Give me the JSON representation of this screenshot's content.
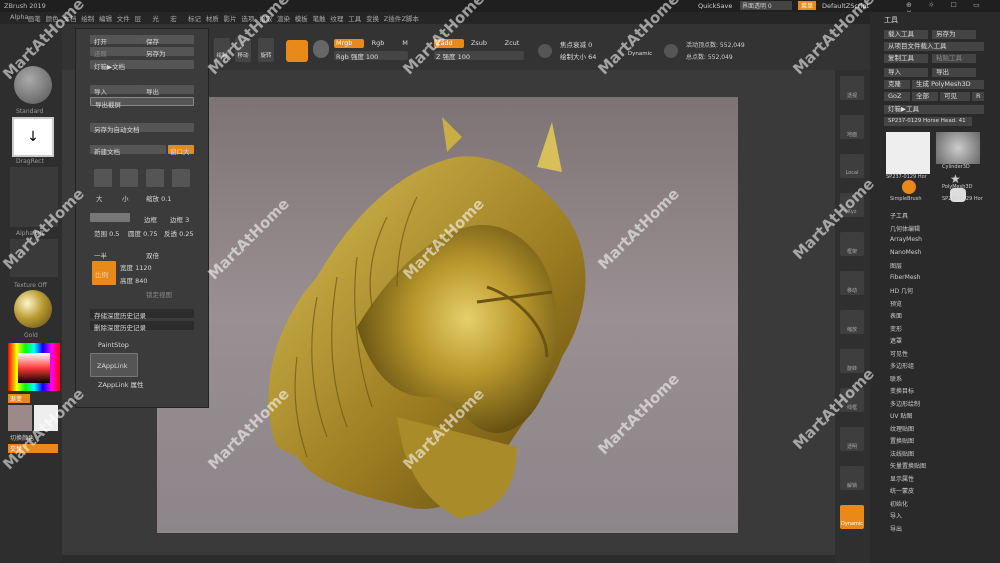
{
  "app": {
    "title": "ZBrush 2019",
    "quicksave": "QuickSave",
    "transparency": "界面透明 0",
    "menu_label": "菜单",
    "script": "DefaultZScript"
  },
  "menubar": [
    "Alpha",
    "画笔",
    "颜色",
    "文档",
    "绘制",
    "编辑",
    "文件",
    "层",
    "光",
    "宏",
    "标记",
    "材质",
    "影片",
    "选项",
    "拾取",
    "渲染",
    "模板",
    "笔触",
    "纹理",
    "工具",
    "变换",
    "Z插件",
    "Z脚本"
  ],
  "toolbar": {
    "edit": "Edit",
    "draw": "绘制",
    "move": "移动",
    "scale": "缩放",
    "rotate": "旋转",
    "mrgb": "Mrgb",
    "rgb": "Rgb",
    "m": "M",
    "zadd": "Zadd",
    "zsub": "Zsub",
    "zcut": "Zcut",
    "rgb_intensity": "Rgb 强度 100",
    "z_intensity": "Z 强度 100",
    "focal": "焦点衰减 0",
    "draw_size": "绘制大小 64",
    "dynamic": "Dynamic",
    "active_points": "活动顶点数: 552,049",
    "total_points": "总点数: 552,049"
  },
  "docmenu": {
    "open": "打开",
    "save": "保存",
    "revert": "还原",
    "save_as": "另存为",
    "lightbox": "灯箱▶文档",
    "import": "导入",
    "export": "导出",
    "export_screen": "导出截屏",
    "save_as_auto": "另存为自动文档",
    "new_doc": "新建文档",
    "wsize": "窗口大",
    "zoom_icons": [
      "实际",
      "AAHalf",
      "缩放",
      "反缩放"
    ],
    "big": "大",
    "small": "小",
    "zoom_val": "缩放 0.1",
    "range": "范围 0.5",
    "contrast": "边框",
    "border": "边框 3",
    "roundness": "圆度 0.75",
    "transp": "反透 0.25",
    "prop": "比例",
    "wide": "宽度 1120",
    "high": "高度 840",
    "half": "一半",
    "double": "双倍",
    "lock_view": "锁定视图",
    "store_depth": "存储深度历史记录",
    "delete_depth": "删除深度历史记录",
    "paintstop": "PaintStop",
    "zapplink": "ZAppLink",
    "zapplink_props": "ZAppLink 属性"
  },
  "leftshelf": {
    "brush": "Standard",
    "stroke": "DragRect",
    "alpha": "Alpha Off",
    "texture": "Texture Off",
    "material": "Gold",
    "main_color": "渐变",
    "switch_color": "切换颜色",
    "alt": "交替"
  },
  "rightshelf": [
    "透视",
    "地面",
    "Local",
    "Xyz",
    "框架",
    "移动",
    "缩放",
    "旋转",
    "线框",
    "透明",
    "解锁",
    "Dynamic"
  ],
  "toolpanel": {
    "title": "工具",
    "load": "载入工具",
    "save_as": "另存为",
    "load_from": "从项目文件载入工具",
    "copy": "复制工具",
    "paste": "粘贴工具",
    "import": "导入",
    "export": "导出",
    "clone": "克隆",
    "make_poly": "生成 PolyMesh3D",
    "goz": "GoZ",
    "all": "全部",
    "visible": "可见",
    "r": "R",
    "lightbox": "灯箱▶工具",
    "current": "SP237-0129 Horse Head. 41",
    "subtools": [
      {
        "name": "SP237-0129 Hor"
      },
      {
        "name": "Cylinder3D"
      },
      {
        "name": "SimpleBrush"
      },
      {
        "name": "PolyMesh3D"
      },
      {
        "name": "SP237-0129 Hor"
      }
    ],
    "sections": [
      "子工具",
      "几何体编辑",
      "ArrayMesh",
      "NanoMesh",
      "图层",
      "FiberMesh",
      "HD 几何",
      "预览",
      "表面",
      "变形",
      "遮罩",
      "可见性",
      "多边形组",
      "联系",
      "变换目标",
      "多边形绘制",
      "UV 贴图",
      "纹理贴图",
      "置换贴图",
      "法线贴图",
      "矢量置换贴图",
      "显示属性",
      "统一蒙皮",
      "初始化",
      "导入",
      "导出"
    ]
  },
  "watermark": "MartAtHome"
}
